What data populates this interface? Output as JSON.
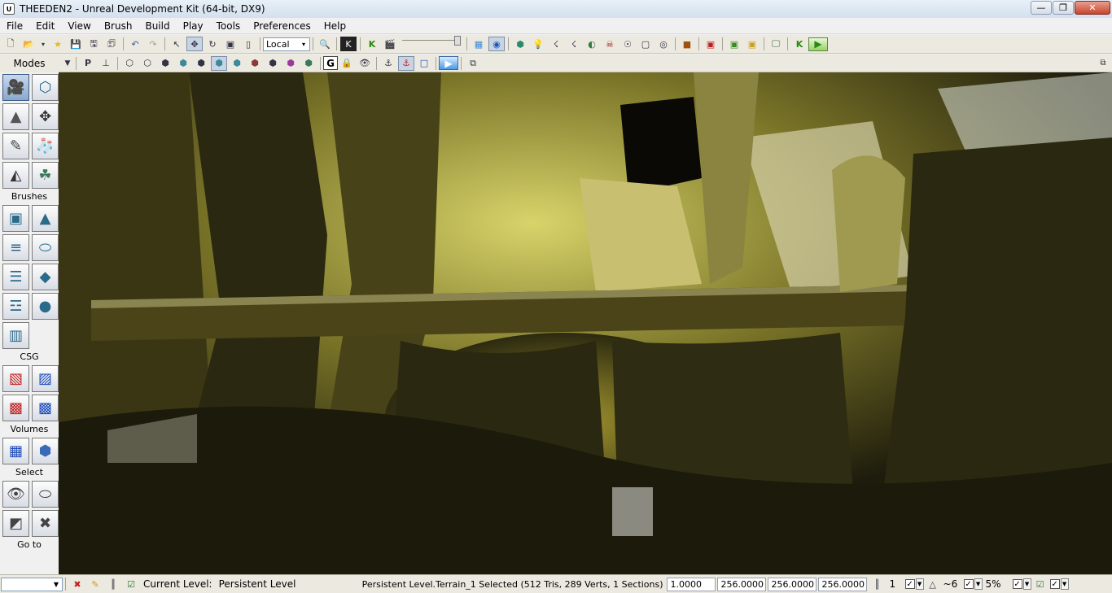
{
  "window": {
    "title": "THEEDEN2 - Unreal Development Kit (64-bit, DX9)",
    "minimize": "—",
    "restore": "❐",
    "close": "✕"
  },
  "menu": [
    "File",
    "Edit",
    "View",
    "Brush",
    "Build",
    "Play",
    "Tools",
    "Preferences",
    "Help"
  ],
  "toolbar": {
    "coord_system": "Local",
    "transform_arrow": "▾"
  },
  "modes_panel": {
    "header": "Modes",
    "sections": {
      "brushes": "Brushes",
      "csg": "CSG",
      "volumes": "Volumes",
      "select": "Select",
      "goto": "Go to"
    }
  },
  "toolbar2": {
    "g_button": "G"
  },
  "status": {
    "current_level_label": "Current Level:",
    "current_level_value": "Persistent Level",
    "selection_info": "Persistent Level.Terrain_1 Selected (512 Tris, 289 Verts, 1 Sections)",
    "drag_scale": "1.0000",
    "scale_x": "256.0000",
    "scale_y": "256.0000",
    "scale_z": "256.0000",
    "grid_size": "1",
    "rotation_snap": "~6",
    "scale_snap": "5%"
  }
}
